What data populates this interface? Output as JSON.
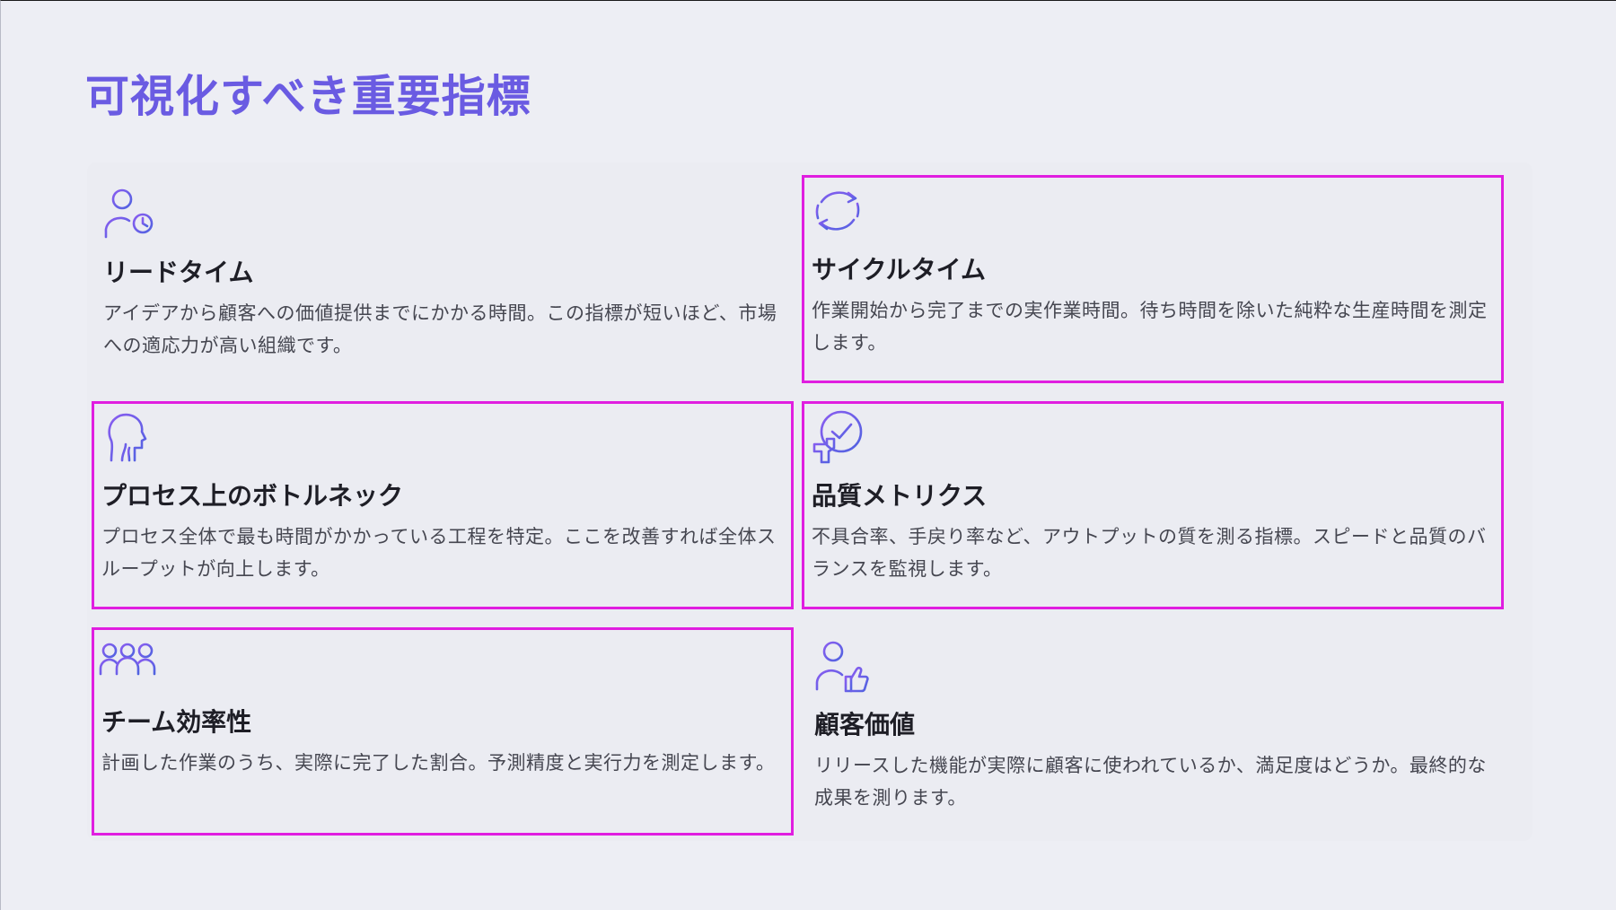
{
  "page": {
    "title": "可視化すべき重要指標"
  },
  "colors": {
    "background": "#edeef4",
    "title": "#6a5be2",
    "icon_gradient_start": "#8a5cf0",
    "icon_gradient_end": "#4f63e0",
    "highlight_border": "#e01ee0"
  },
  "cards": [
    {
      "icon": "person-clock-icon",
      "title": "リードタイム",
      "description": "アイデアから顧客への価値提供までにかかる時間。この指標が短いほど、市場への適応力が高い組織です。"
    },
    {
      "icon": "cycle-arrows-icon",
      "title": "サイクルタイム",
      "description": "作業開始から完了までの実作業時間。待ち時間を除いた純粋な生産時間を測定します。"
    },
    {
      "icon": "head-bottleneck-icon",
      "title": "プロセス上のボトルネック",
      "description": "プロセス全体で最も時間がかかっている工程を特定。ここを改善すれば全体スループットが向上します。"
    },
    {
      "icon": "quality-check-icon",
      "title": "品質メトリクス",
      "description": "不具合率、手戻り率など、アウトプットの質を測る指標。スピードと品質のバランスを監視します。"
    },
    {
      "icon": "team-icon",
      "title": "チーム効率性",
      "description": "計画した作業のうち、実際に完了した割合。予測精度と実行力を測定します。"
    },
    {
      "icon": "person-thumbs-up-icon",
      "title": "顧客価値",
      "description": "リリースした機能が実際に顧客に使われているか、満足度はどうか。最終的な成果を測ります。"
    }
  ]
}
